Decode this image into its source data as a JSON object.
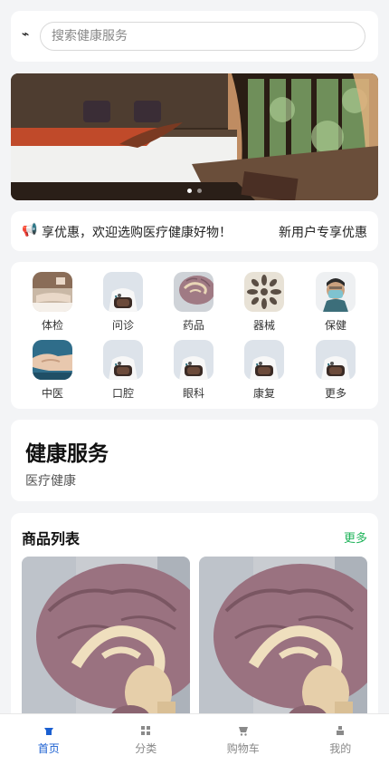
{
  "search": {
    "placeholder": "搜索健康服务",
    "logo_glyph": "⌁"
  },
  "banner": {
    "image": "bedroom-photo",
    "slides": 2,
    "active_slide": 1
  },
  "notice": {
    "icon": "speaker-icon",
    "text": "享优惠，欢迎选购医疗健康好物！",
    "right_text": "新用户专享优惠"
  },
  "categories": [
    {
      "label": "体检",
      "image": "massage-photo"
    },
    {
      "label": "问诊",
      "image": "doctor-photo"
    },
    {
      "label": "药品",
      "image": "brain-model-photo"
    },
    {
      "label": "器械",
      "image": "pattern-photo"
    },
    {
      "label": "保健",
      "image": "masked-doctor-photo"
    },
    {
      "label": "中医",
      "image": "hands-photo"
    },
    {
      "label": "口腔",
      "image": "doctor-photo"
    },
    {
      "label": "眼科",
      "image": "doctor-photo"
    },
    {
      "label": "康复",
      "image": "doctor-photo"
    },
    {
      "label": "更多",
      "image": "doctor-photo"
    }
  ],
  "service": {
    "title": "健康服务",
    "subtitle": "医疗健康"
  },
  "products": {
    "title": "商品列表",
    "more_label": "更多",
    "items": [
      "brain-model-photo",
      "brain-model-photo"
    ]
  },
  "tabbar": {
    "items": [
      {
        "label": "首页",
        "icon": "home-icon",
        "active": true
      },
      {
        "label": "分类",
        "icon": "grid-icon",
        "active": false
      },
      {
        "label": "购物车",
        "icon": "cart-icon",
        "active": false
      },
      {
        "label": "我的",
        "icon": "user-icon",
        "active": false
      }
    ]
  },
  "colors": {
    "accent": "#1a5fd1",
    "more_link": "#1fb35a",
    "background": "#f3f4f6"
  }
}
